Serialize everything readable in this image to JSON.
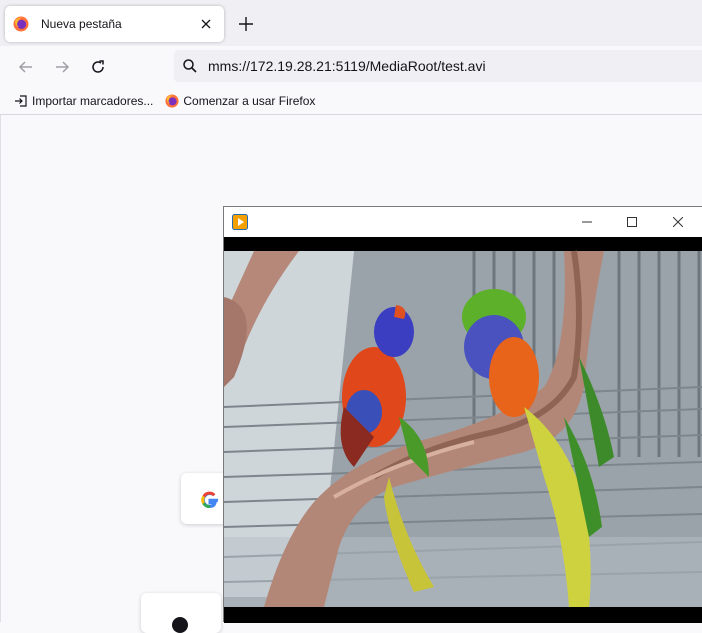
{
  "browser": {
    "tab": {
      "title": "Nueva pestaña"
    },
    "url": "mms://172.19.28.21:5119/MediaRoot/test.avi",
    "bookmarks": [
      {
        "label": "Importar marcadores...",
        "icon": "import-icon"
      },
      {
        "label": "Comenzar a usar Firefox",
        "icon": "firefox-icon"
      }
    ]
  },
  "player": {
    "icon": "media-player-icon",
    "buttons": [
      "minimize-icon",
      "maximize-icon",
      "close-icon"
    ]
  },
  "colors": {
    "tab_strip": "#f0f0f4",
    "toolbar": "#f9f9fb",
    "urlbar": "#f0f0f4",
    "player_accent": "#f4a000"
  }
}
